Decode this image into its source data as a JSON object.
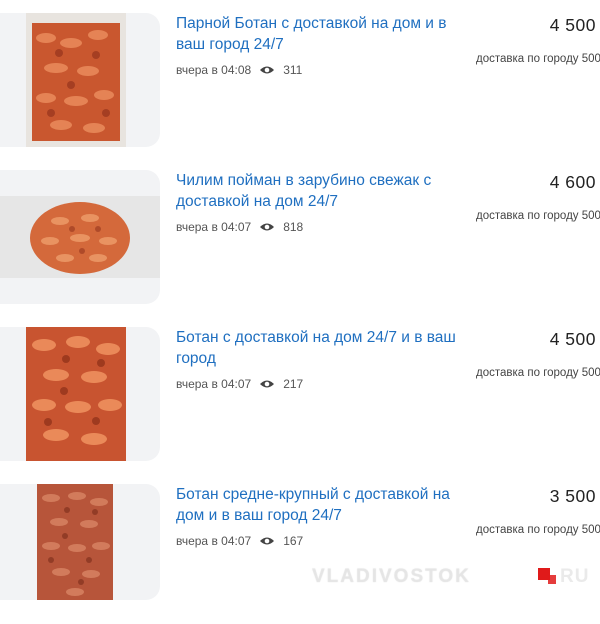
{
  "listings": [
    {
      "title": "Парной Ботан с доставкой на дом и в ваш город 24/7",
      "time": "вчера в 04:08",
      "views": "311",
      "price": "4 500",
      "delivery": "доставка по городу 500"
    },
    {
      "title": "Чилим пойман в зарубино свежак с доставкой на дом 24/7",
      "time": "вчера в 04:07",
      "views": "818",
      "price": "4 600",
      "delivery": "доставка по городу 500"
    },
    {
      "title": "Ботан с доставкой на дом 24/7 и в ваш город",
      "time": "вчера в 04:07",
      "views": "217",
      "price": "4 500",
      "delivery": "доставка по городу 500"
    },
    {
      "title": "Ботан средне-крупный с доставкой на дом и в ваш город 24/7",
      "time": "вчера в 04:07",
      "views": "167",
      "price": "3 500",
      "delivery": "доставка по городу 500"
    }
  ],
  "icons": {
    "views": "eye-icon",
    "watermark_logo": "red-square-logo-icon"
  },
  "colors": {
    "title_link": "#1f6fc0",
    "meta_text": "#555555",
    "card_bg": "#f2f3f5",
    "shrimp": "#d9683c"
  },
  "watermark": {
    "text": "VLADIVOSTOK",
    "suffix": "RU"
  }
}
